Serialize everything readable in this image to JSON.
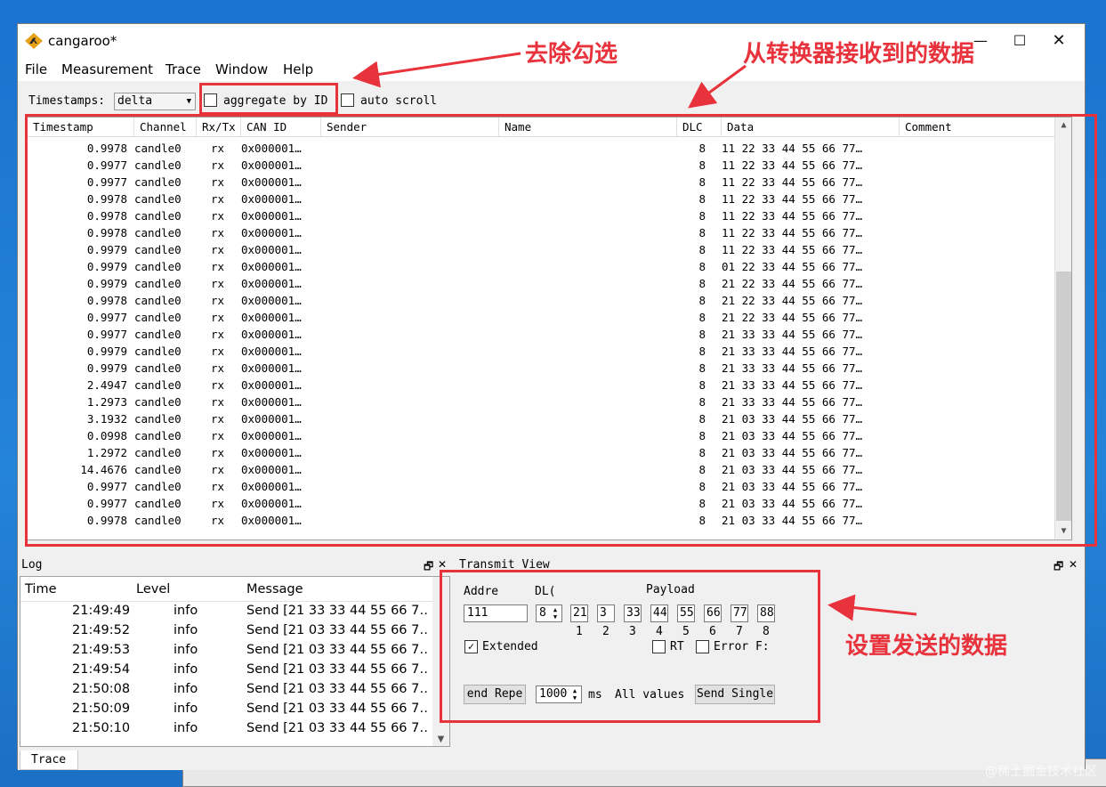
{
  "window": {
    "title": "cangaroo*",
    "close_glyph": "✕",
    "minimize_glyph": "—",
    "maximize_glyph": "☐"
  },
  "menu": [
    "File",
    "Measurement",
    "Trace",
    "Window",
    "Help"
  ],
  "toolbar": {
    "timestamps_label": "Timestamps:",
    "timestamps_value": "delta",
    "aggregate_label": "aggregate by ID",
    "autoscroll_label": "auto scroll"
  },
  "trace": {
    "columns": [
      "Timestamp",
      "Channel",
      "Rx/Tx",
      "CAN ID",
      "Sender",
      "Name",
      "DLC",
      "Data",
      "Comment"
    ],
    "rows": [
      [
        "0.9978",
        "candle0",
        "rx",
        "0x000001…",
        "",
        "",
        "8",
        "11 22 33 44 55 66 77…"
      ],
      [
        "0.9977",
        "candle0",
        "rx",
        "0x000001…",
        "",
        "",
        "8",
        "11 22 33 44 55 66 77…"
      ],
      [
        "0.9977",
        "candle0",
        "rx",
        "0x000001…",
        "",
        "",
        "8",
        "11 22 33 44 55 66 77…"
      ],
      [
        "0.9978",
        "candle0",
        "rx",
        "0x000001…",
        "",
        "",
        "8",
        "11 22 33 44 55 66 77…"
      ],
      [
        "0.9978",
        "candle0",
        "rx",
        "0x000001…",
        "",
        "",
        "8",
        "11 22 33 44 55 66 77…"
      ],
      [
        "0.9978",
        "candle0",
        "rx",
        "0x000001…",
        "",
        "",
        "8",
        "11 22 33 44 55 66 77…"
      ],
      [
        "0.9979",
        "candle0",
        "rx",
        "0x000001…",
        "",
        "",
        "8",
        "11 22 33 44 55 66 77…"
      ],
      [
        "0.9979",
        "candle0",
        "rx",
        "0x000001…",
        "",
        "",
        "8",
        "01 22 33 44 55 66 77…"
      ],
      [
        "0.9979",
        "candle0",
        "rx",
        "0x000001…",
        "",
        "",
        "8",
        "21 22 33 44 55 66 77…"
      ],
      [
        "0.9978",
        "candle0",
        "rx",
        "0x000001…",
        "",
        "",
        "8",
        "21 22 33 44 55 66 77…"
      ],
      [
        "0.9977",
        "candle0",
        "rx",
        "0x000001…",
        "",
        "",
        "8",
        "21 22 33 44 55 66 77…"
      ],
      [
        "0.9977",
        "candle0",
        "rx",
        "0x000001…",
        "",
        "",
        "8",
        "21 33 33 44 55 66 77…"
      ],
      [
        "0.9979",
        "candle0",
        "rx",
        "0x000001…",
        "",
        "",
        "8",
        "21 33 33 44 55 66 77…"
      ],
      [
        "0.9979",
        "candle0",
        "rx",
        "0x000001…",
        "",
        "",
        "8",
        "21 33 33 44 55 66 77…"
      ],
      [
        "2.4947",
        "candle0",
        "rx",
        "0x000001…",
        "",
        "",
        "8",
        "21 33 33 44 55 66 77…"
      ],
      [
        "1.2973",
        "candle0",
        "rx",
        "0x000001…",
        "",
        "",
        "8",
        "21 33 33 44 55 66 77…"
      ],
      [
        "3.1932",
        "candle0",
        "rx",
        "0x000001…",
        "",
        "",
        "8",
        "21 03 33 44 55 66 77…"
      ],
      [
        "0.0998",
        "candle0",
        "rx",
        "0x000001…",
        "",
        "",
        "8",
        "21 03 33 44 55 66 77…"
      ],
      [
        "1.2972",
        "candle0",
        "rx",
        "0x000001…",
        "",
        "",
        "8",
        "21 03 33 44 55 66 77…"
      ],
      [
        "14.4676",
        "candle0",
        "rx",
        "0x000001…",
        "",
        "",
        "8",
        "21 03 33 44 55 66 77…"
      ],
      [
        "0.9977",
        "candle0",
        "rx",
        "0x000001…",
        "",
        "",
        "8",
        "21 03 33 44 55 66 77…"
      ],
      [
        "0.9977",
        "candle0",
        "rx",
        "0x000001…",
        "",
        "",
        "8",
        "21 03 33 44 55 66 77…"
      ],
      [
        "0.9978",
        "candle0",
        "rx",
        "0x000001…",
        "",
        "",
        "8",
        "21 03 33 44 55 66 77…"
      ]
    ]
  },
  "log": {
    "title": "Log",
    "columns": [
      "Time",
      "Level",
      "Message"
    ],
    "rows": [
      [
        "21:49:49",
        "info",
        "Send [21 33 33 44 55 66 7…"
      ],
      [
        "21:49:52",
        "info",
        "Send [21 03 33 44 55 66 7…"
      ],
      [
        "21:49:53",
        "info",
        "Send [21 03 33 44 55 66 7…"
      ],
      [
        "21:49:54",
        "info",
        "Send [21 03 33 44 55 66 7…"
      ],
      [
        "21:50:08",
        "info",
        "Send [21 03 33 44 55 66 7…"
      ],
      [
        "21:50:09",
        "info",
        "Send [21 03 33 44 55 66 7…"
      ],
      [
        "21:50:10",
        "info",
        "Send [21 03 33 44 55 66 7…"
      ]
    ]
  },
  "transmit": {
    "title": "Transmit View",
    "address_label": "Addre",
    "dlc_label": "DL(",
    "payload_label": "Payload",
    "address_value": "111",
    "dlc_value": "8",
    "payload": [
      "21",
      "3",
      "33",
      "44",
      "55",
      "66",
      "77",
      "88"
    ],
    "byte_index": [
      "1",
      "2",
      "3",
      "4",
      "5",
      "6",
      "7",
      "8"
    ],
    "extended_label": "Extended",
    "rtr_label": "RT",
    "error_label": "Error F:",
    "send_repeat_label": "end Repe",
    "interval_value": "1000",
    "ms_label": "ms",
    "all_values_label": "All values",
    "send_single_label": "Send Single"
  },
  "status": {
    "tab_label": "Trace"
  },
  "annotations": {
    "uncheck": "去除勾选",
    "received": "从转换器接收到的数据",
    "set_send": "设置发送的数据"
  },
  "watermark": "@稀土掘金技术社区",
  "colors": {
    "annotation": "#e8323c",
    "desktop": "#1d7ad4"
  }
}
